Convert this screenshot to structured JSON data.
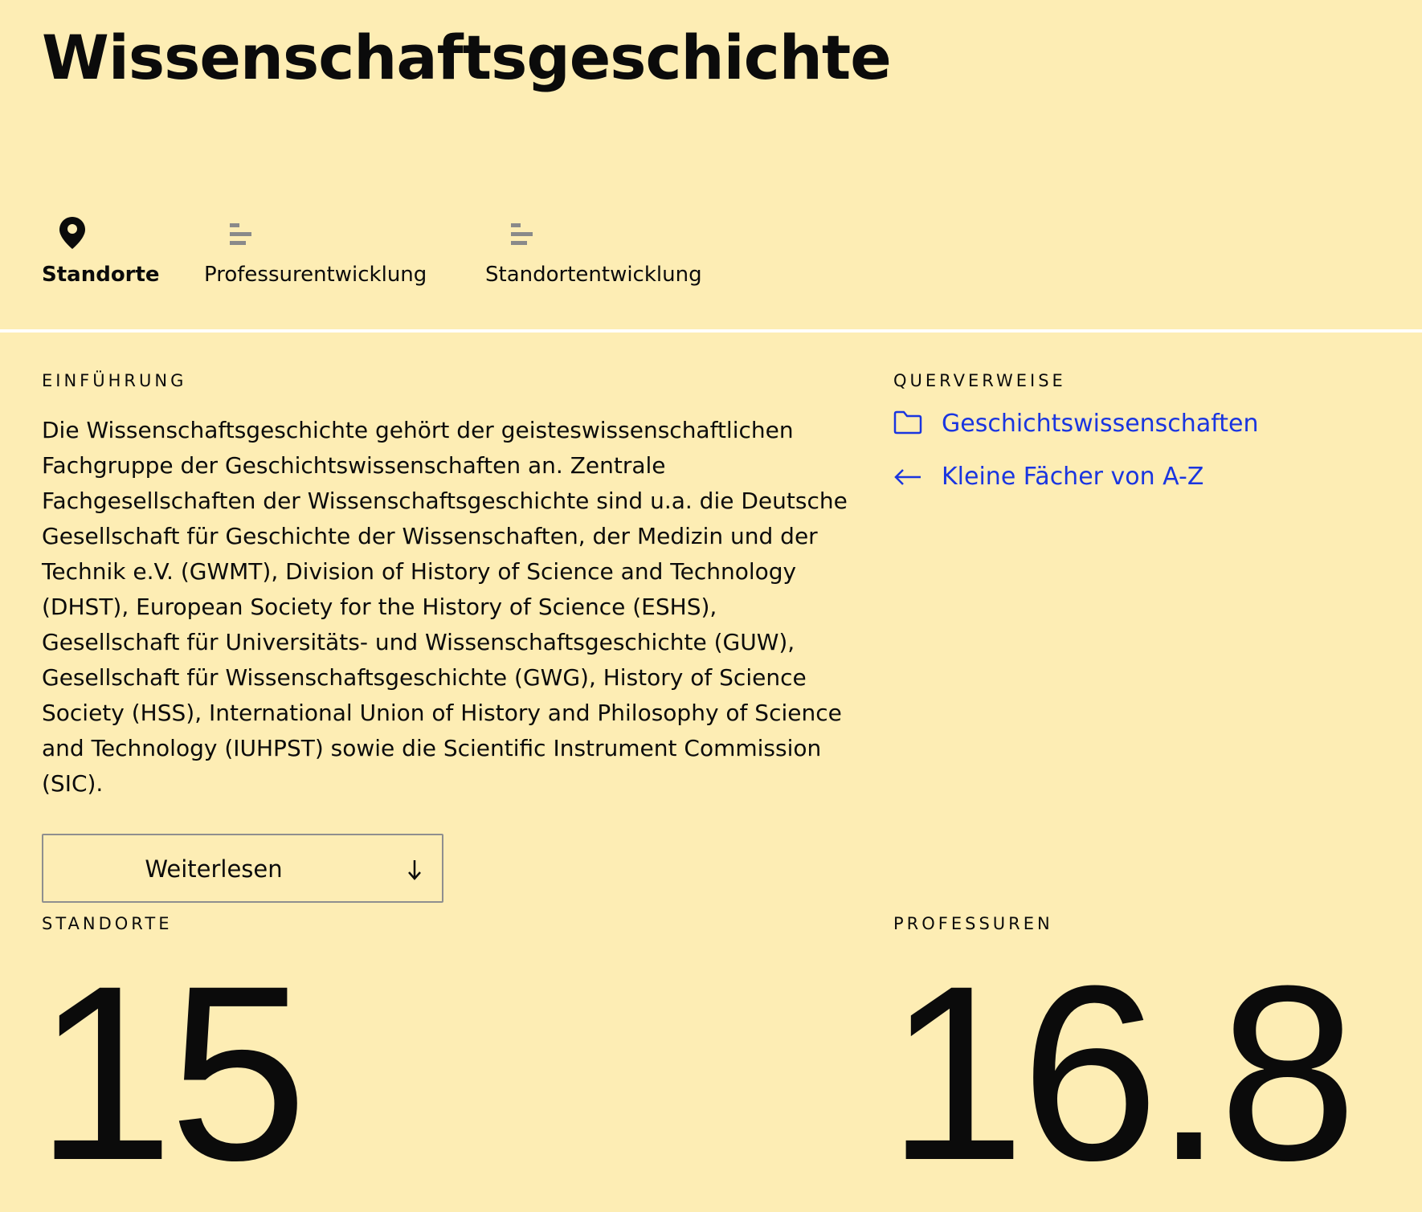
{
  "page": {
    "title": "Wissenschaftsgeschichte"
  },
  "tabs": [
    {
      "label": "Standorte",
      "icon": "map-pin-icon",
      "active": true
    },
    {
      "label": "Professurentwicklung",
      "icon": "bar-chart-icon",
      "active": false
    },
    {
      "label": "Standortentwicklung",
      "icon": "bar-chart-icon",
      "active": false
    }
  ],
  "intro": {
    "heading": "EINFÜHRUNG",
    "text": "Die Wissenschaftsgeschichte gehört der geisteswissenschaftli­chen Fachgruppe der Geschichtswissenschaften an. Zentrale Fachgesellschaften der Wissenschaftsgeschichte sind u.a. die Deutsche Gesellschaft für Geschichte der Wissenschaften, der Me­dizin und der Technik  e.V. (GWMT), Division of History of Science and Technology (DHST), European Society for the History of Sci­ence (ESHS), Gesellschaft für Universitäts- und Wissenschaftsge­schichte (GUW), Gesellschaft für Wissenschaftsgeschichte (GWG), History of Science Society (HSS), International Union of History and Philosophy of Science and Technology (IUHPST) sowie die Scienti­fic Instrument Commission (SIC).",
    "read_more_label": "Weiterlesen",
    "read_more_icon": "arrow-down-icon"
  },
  "cross_references": {
    "heading": "QUERVERWEISE",
    "links": [
      {
        "label": "Geschichtswissenschaften",
        "icon": "folder-icon"
      },
      {
        "label": "Kleine Fächer von A-Z",
        "icon": "arrow-left-icon"
      }
    ]
  },
  "stats": {
    "locations_heading": "STANDORTE",
    "locations_value": "15",
    "professorships_heading": "PROFESSUREN",
    "professorships_value": "16.8"
  },
  "colors": {
    "background": "#fdedb4",
    "text": "#0b0b0b",
    "link": "#1a35e0",
    "divider": "#ffffff",
    "icon_muted": "#8a8a8a"
  }
}
